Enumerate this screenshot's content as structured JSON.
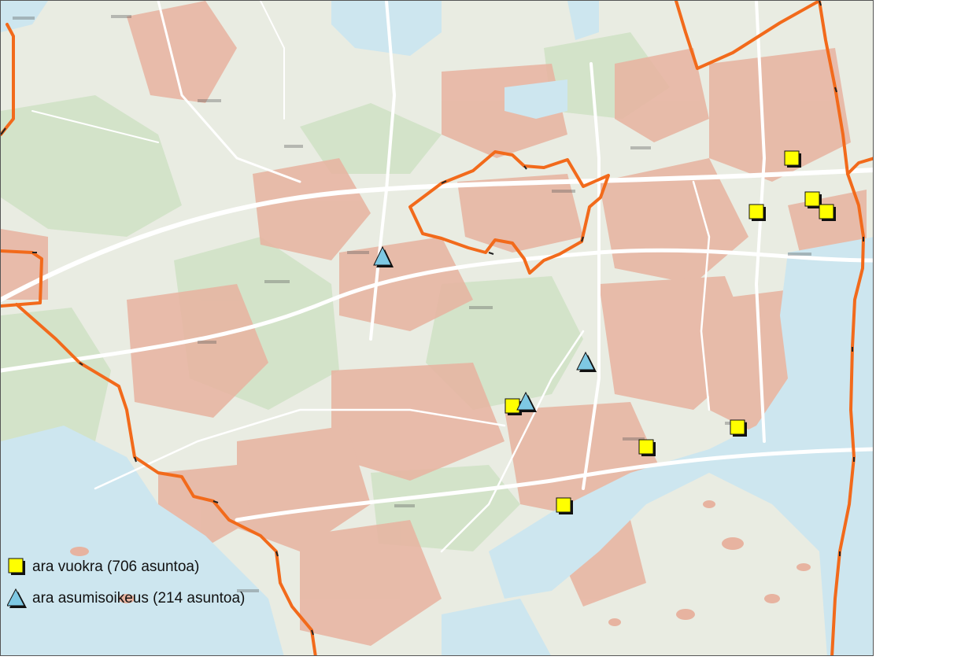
{
  "legend": {
    "rental": {
      "label": "ara vuokra (706 asuntoa)",
      "icon": "yellow-square-icon",
      "color": "#ffff00"
    },
    "right_of_occupancy": {
      "label": "ara asumisoikeus (214 asuntoa)",
      "icon": "blue-triangle-icon",
      "color": "#7ec8e3"
    }
  },
  "colors": {
    "boundary": "#f26a1b",
    "water": "#cfe8ee",
    "forest": "#cfe0c6",
    "built": "#e8a994",
    "roads": "#ffffff",
    "background": "#e9ece2"
  },
  "markers": {
    "rental_count": 10,
    "right_of_occupancy_count": 4
  }
}
